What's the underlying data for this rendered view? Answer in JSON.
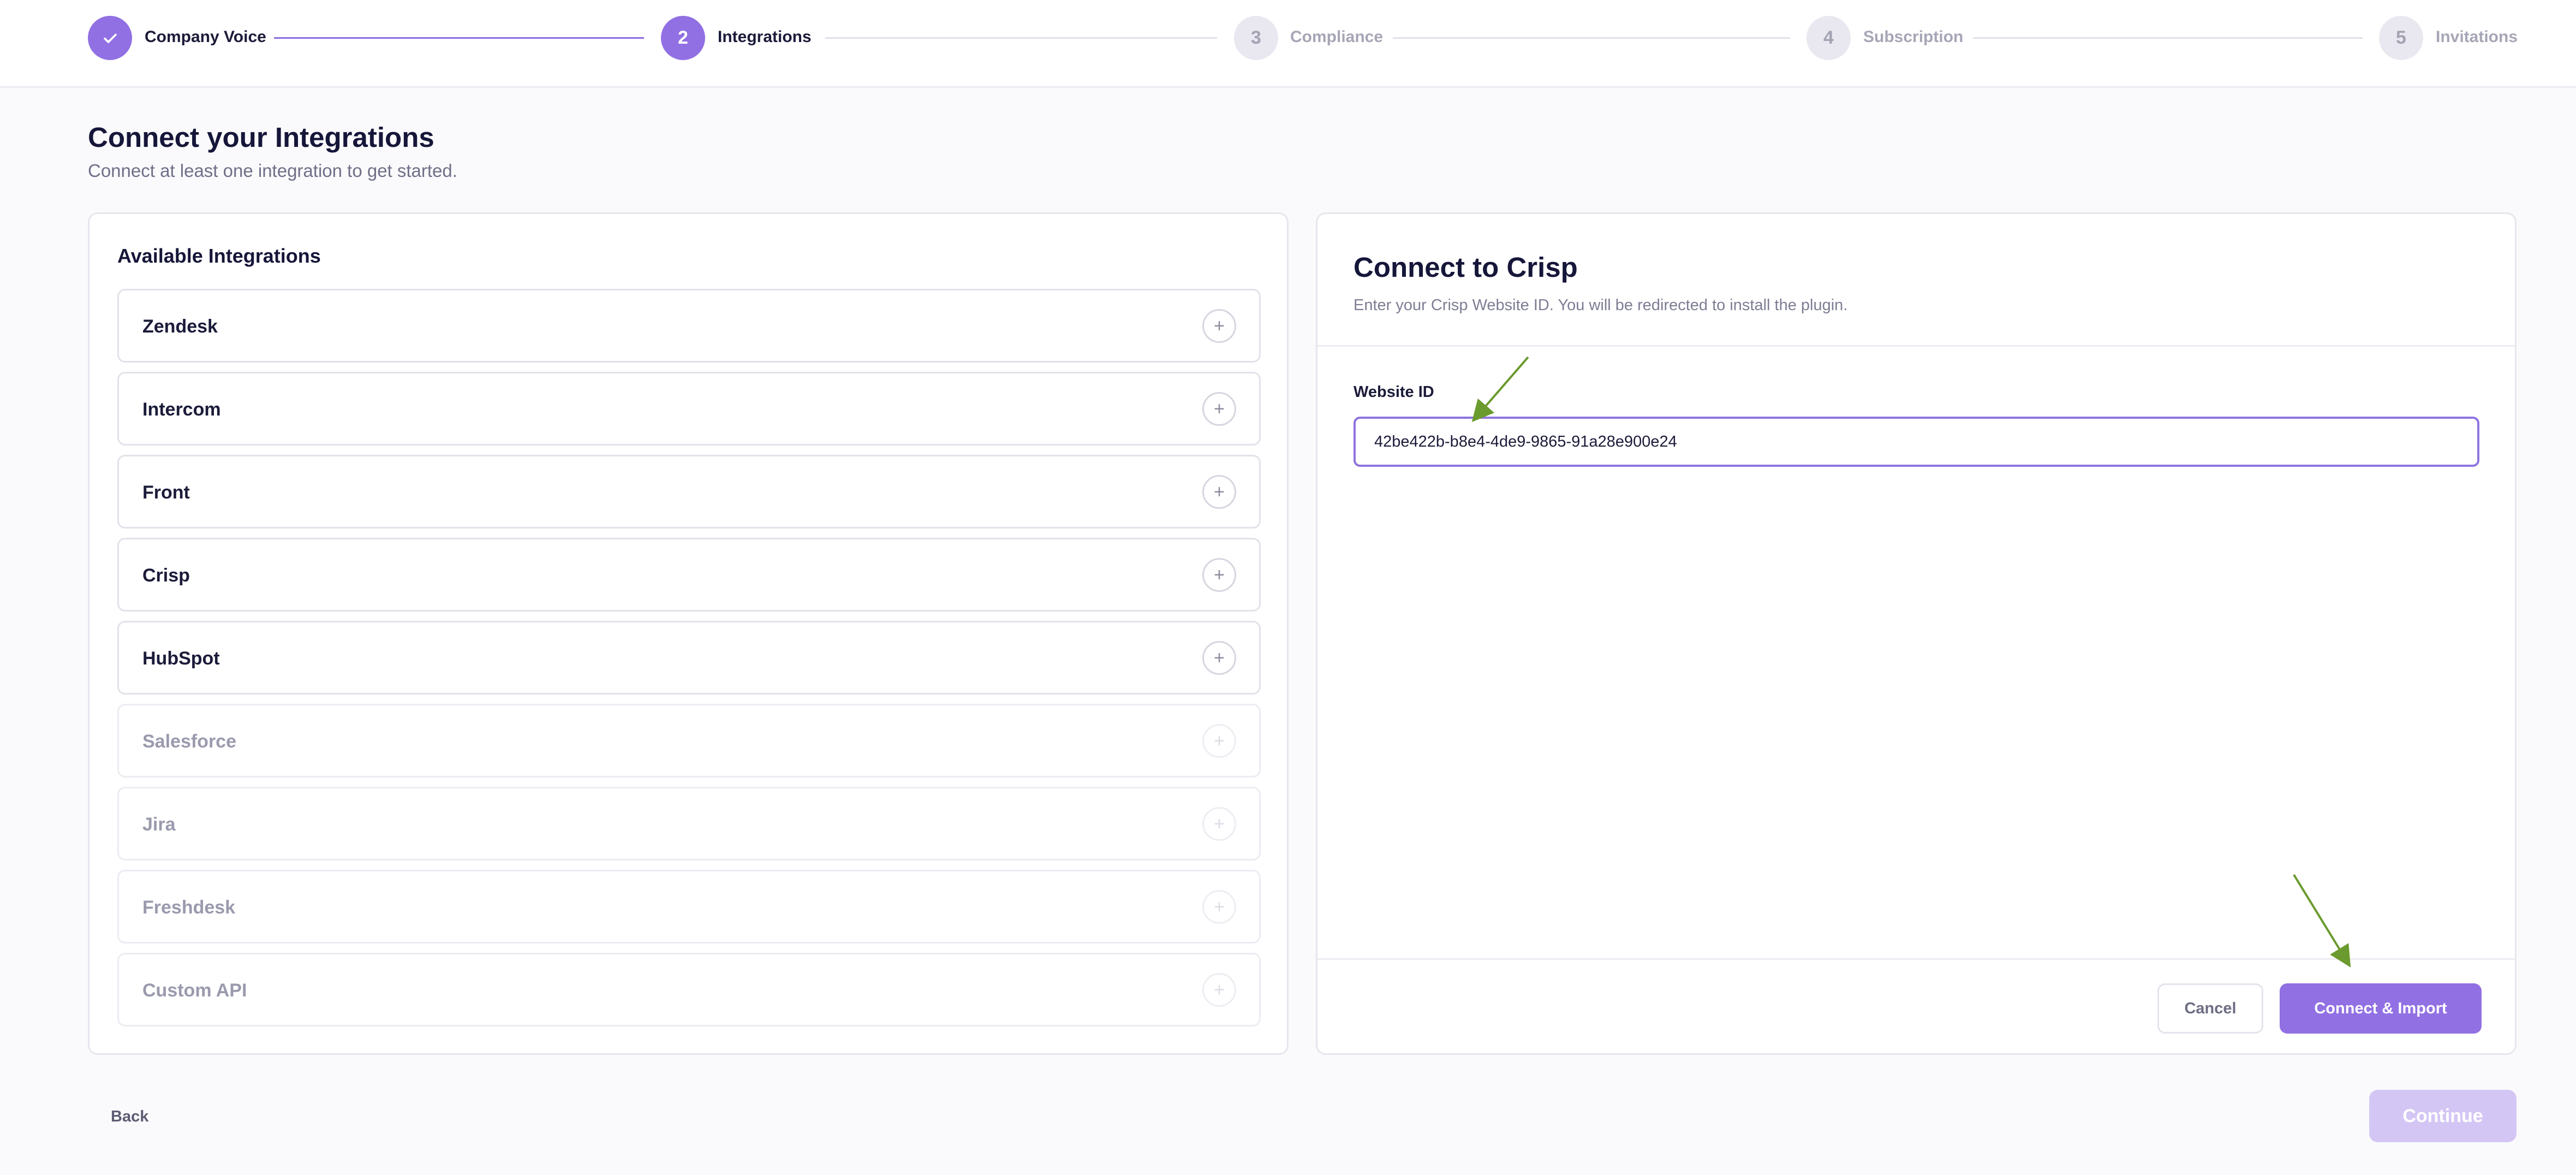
{
  "stepper": {
    "steps": [
      {
        "label": "Company Voice",
        "number": "1",
        "status": "done"
      },
      {
        "label": "Integrations",
        "number": "2",
        "status": "active"
      },
      {
        "label": "Compliance",
        "number": "3",
        "status": "todo"
      },
      {
        "label": "Subscription",
        "number": "4",
        "status": "todo"
      },
      {
        "label": "Invitations",
        "number": "5",
        "status": "todo"
      }
    ]
  },
  "header": {
    "title": "Connect your Integrations",
    "subtitle": "Connect at least one integration to get started."
  },
  "integrations": {
    "title": "Available Integrations",
    "items": [
      {
        "name": "Zendesk",
        "enabled": true
      },
      {
        "name": "Intercom",
        "enabled": true
      },
      {
        "name": "Front",
        "enabled": true
      },
      {
        "name": "Crisp",
        "enabled": true
      },
      {
        "name": "HubSpot",
        "enabled": true
      },
      {
        "name": "Salesforce",
        "enabled": false
      },
      {
        "name": "Jira",
        "enabled": false
      },
      {
        "name": "Freshdesk",
        "enabled": false
      },
      {
        "name": "Custom API",
        "enabled": false
      }
    ],
    "add_icon": "plus-icon"
  },
  "connect_panel": {
    "title": "Connect to Crisp",
    "subtitle": "Enter your Crisp Website ID. You will be redirected to install the plugin.",
    "field_label": "Website ID",
    "field_value": "42be422b-b8e4-4de9-9865-91a28e900e24",
    "cancel_label": "Cancel",
    "connect_label": "Connect & Import"
  },
  "footer": {
    "back_label": "Back",
    "continue_label": "Continue"
  },
  "colors": {
    "accent": "#9170e3",
    "annotation_arrow": "#6b9a2e",
    "disabled_button": "#d4c6f4"
  }
}
